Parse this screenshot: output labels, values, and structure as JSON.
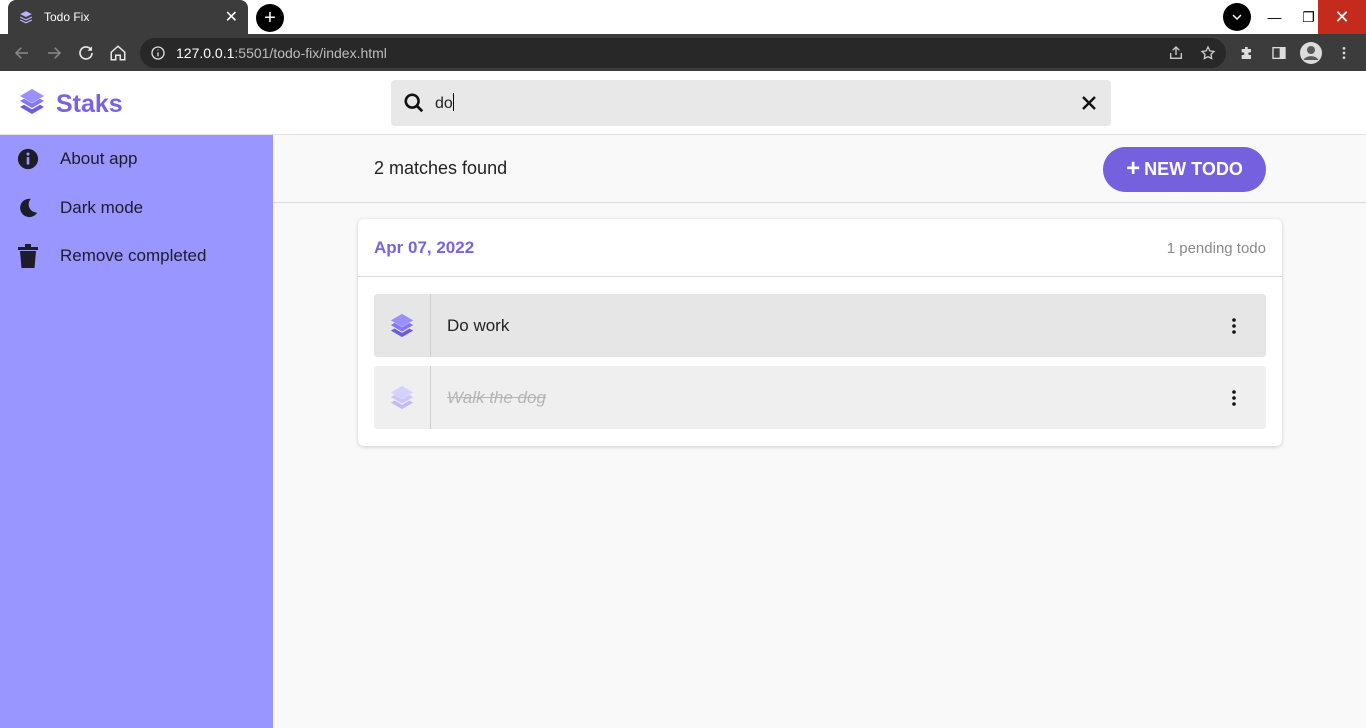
{
  "browser": {
    "tab_title": "Todo Fix",
    "tab_close": "✕",
    "new_tab": "+",
    "url_host": "127.0.0.1",
    "url_rest": ":5501/todo-fix/index.html",
    "window_min": "—",
    "window_max": "❐",
    "window_close": "✕"
  },
  "header": {
    "app_name": "Staks",
    "search_value": "do"
  },
  "sidebar": {
    "items": [
      {
        "label": "About app",
        "icon": "info-icon"
      },
      {
        "label": "Dark mode",
        "icon": "moon-icon"
      },
      {
        "label": "Remove completed",
        "icon": "trash-icon"
      }
    ]
  },
  "main": {
    "matches": "2 matches found",
    "new_todo_plus": "+",
    "new_todo_label": "NEW TODO",
    "groups": [
      {
        "date": "Apr 07, 2022",
        "pending": "1 pending todo",
        "todos": [
          {
            "text": "Do work",
            "completed": false
          },
          {
            "text": "Walk the dog",
            "completed": true
          }
        ]
      }
    ]
  },
  "colors": {
    "accent": "#7560dd",
    "sidebar_bg": "#9a96ff",
    "date_text": "#7a63e0"
  }
}
